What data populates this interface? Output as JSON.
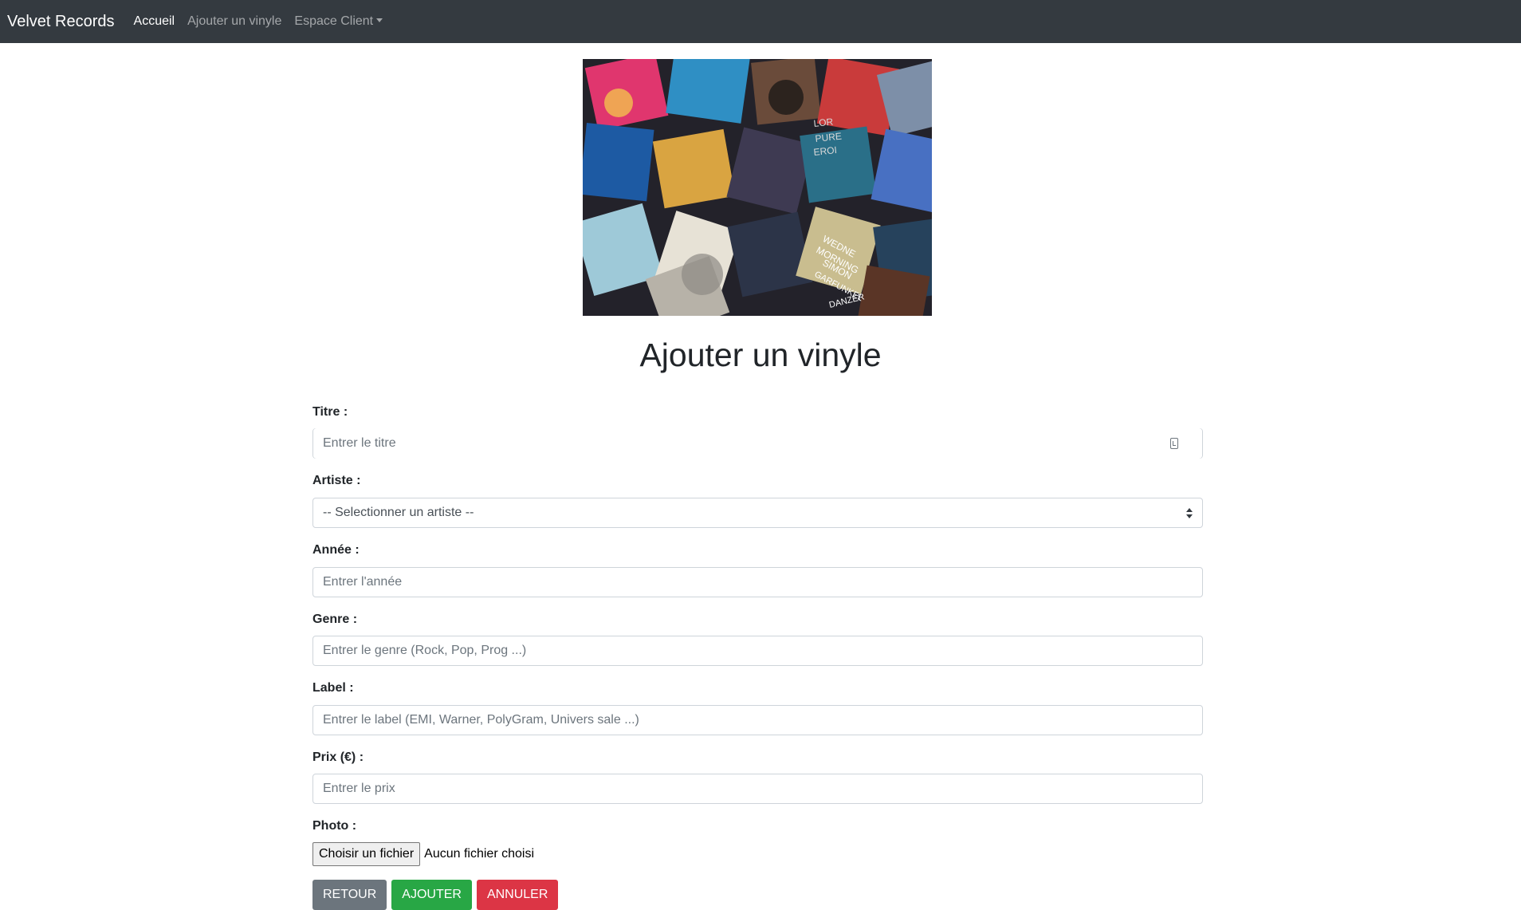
{
  "navbar": {
    "brand": "Velvet Records",
    "links": [
      {
        "label": "Accueil",
        "active": true
      },
      {
        "label": "Ajouter un vinyle",
        "active": false
      },
      {
        "label": "Espace Client",
        "dropdown": true
      }
    ]
  },
  "hero_image": {
    "text_fragments": [
      "LOR",
      "PURE",
      "EROI",
      "WEDNE",
      "MORNING",
      "SIMON",
      "GARFUNKEL",
      "DANZER"
    ]
  },
  "page": {
    "title": "Ajouter un vinyle"
  },
  "form": {
    "titre_label": "Titre :",
    "titre_placeholder": "Entrer le titre",
    "artiste_label": "Artiste :",
    "artiste_selected": "-- Selectionner un artiste --",
    "annee_label": "Année :",
    "annee_placeholder": "Entrer l'année",
    "genre_label": "Genre :",
    "genre_placeholder": "Entrer le genre (Rock, Pop, Prog ...)",
    "label_label": "Label :",
    "label_placeholder": "Entrer le label (EMI, Warner, PolyGram, Univers sale ...)",
    "prix_label": "Prix (€) :",
    "prix_placeholder": "Entrer le prix",
    "photo_label": "Photo :",
    "file_button": "Choisir un fichier",
    "file_status": "Aucun fichier choisi"
  },
  "buttons": {
    "retour": "RETOUR",
    "ajouter": "AJOUTER",
    "annuler": "ANNULER"
  },
  "colors": {
    "navbar": "#343a40",
    "retour": "#6c757d",
    "ajouter": "#28a745",
    "annuler": "#dc3545"
  }
}
